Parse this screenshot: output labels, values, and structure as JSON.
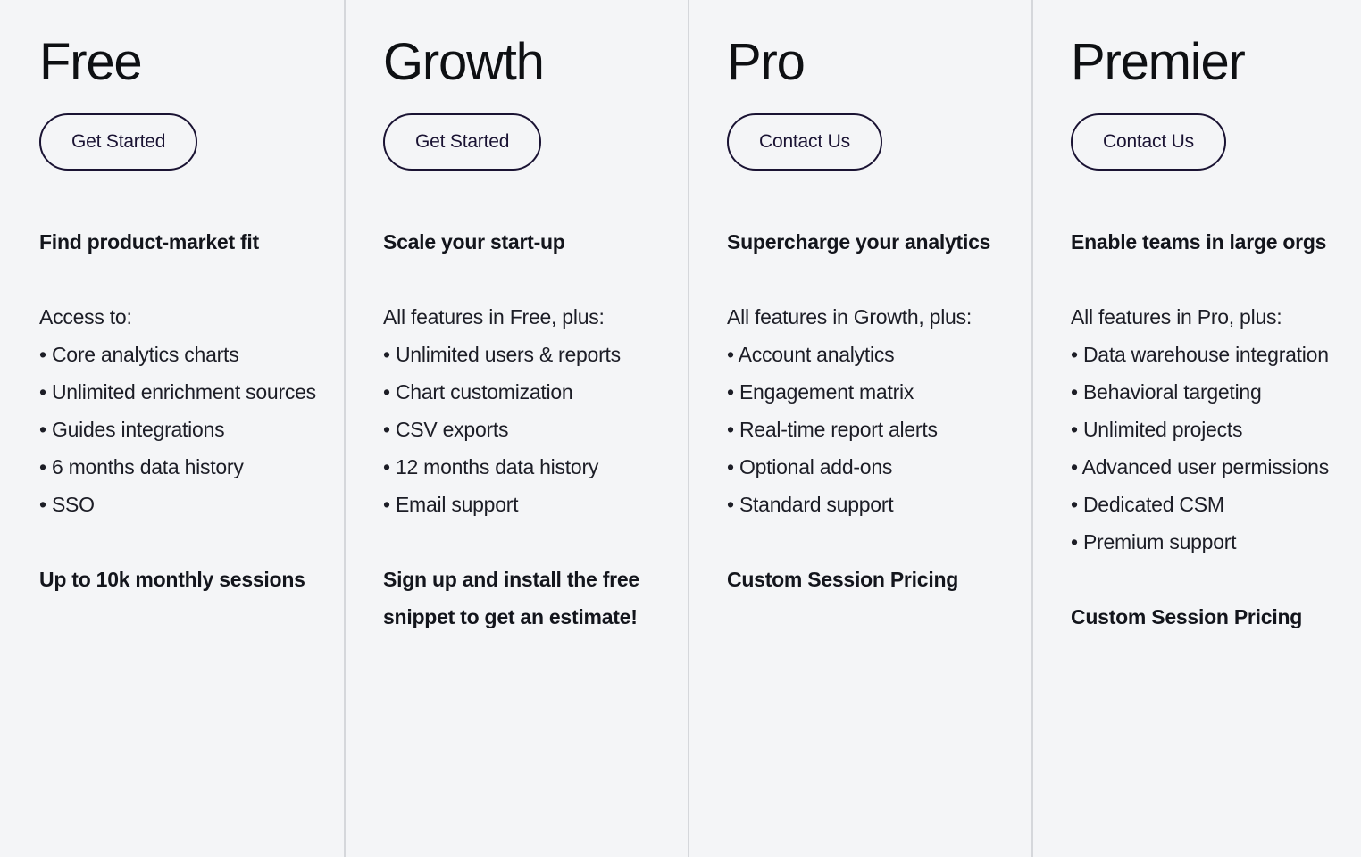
{
  "page": {
    "background_color": "#f4f5f7",
    "text_color": "#1c1d26",
    "accent_color": "#1a1333",
    "divider_color": "#d5d7db"
  },
  "plans": [
    {
      "name": "Free",
      "cta_label": "Get Started",
      "tagline": "Find product-market fit",
      "intro": "Access to:",
      "features": [
        "• Core analytics charts",
        "• Unlimited enrichment sources",
        "• Guides integrations",
        "• 6 months data history",
        "• SSO"
      ],
      "footnote": "Up to 10k monthly sessions"
    },
    {
      "name": "Growth",
      "cta_label": "Get Started",
      "tagline": "Scale your start-up",
      "intro": "All features in Free, plus:",
      "features": [
        "• Unlimited users & reports",
        "• Chart customization",
        "• CSV exports",
        "• 12 months data history",
        "• Email support"
      ],
      "footnote": "Sign up and install the free snippet to get an estimate!"
    },
    {
      "name": "Pro",
      "cta_label": "Contact Us",
      "tagline": "Supercharge your analytics",
      "intro": "All features in Growth, plus:",
      "features": [
        "• Account analytics",
        "• Engagement matrix",
        "• Real-time report alerts",
        "• Optional add-ons",
        "• Standard support"
      ],
      "footnote": "Custom Session Pricing"
    },
    {
      "name": "Premier",
      "cta_label": "Contact Us",
      "tagline": "Enable teams in large orgs",
      "intro": "All features in Pro, plus:",
      "features": [
        "• Data warehouse integration",
        "• Behavioral targeting",
        "• Unlimited projects",
        "• Advanced user permissions",
        "• Dedicated CSM",
        "• Premium support"
      ],
      "footnote": "Custom Session Pricing"
    }
  ]
}
